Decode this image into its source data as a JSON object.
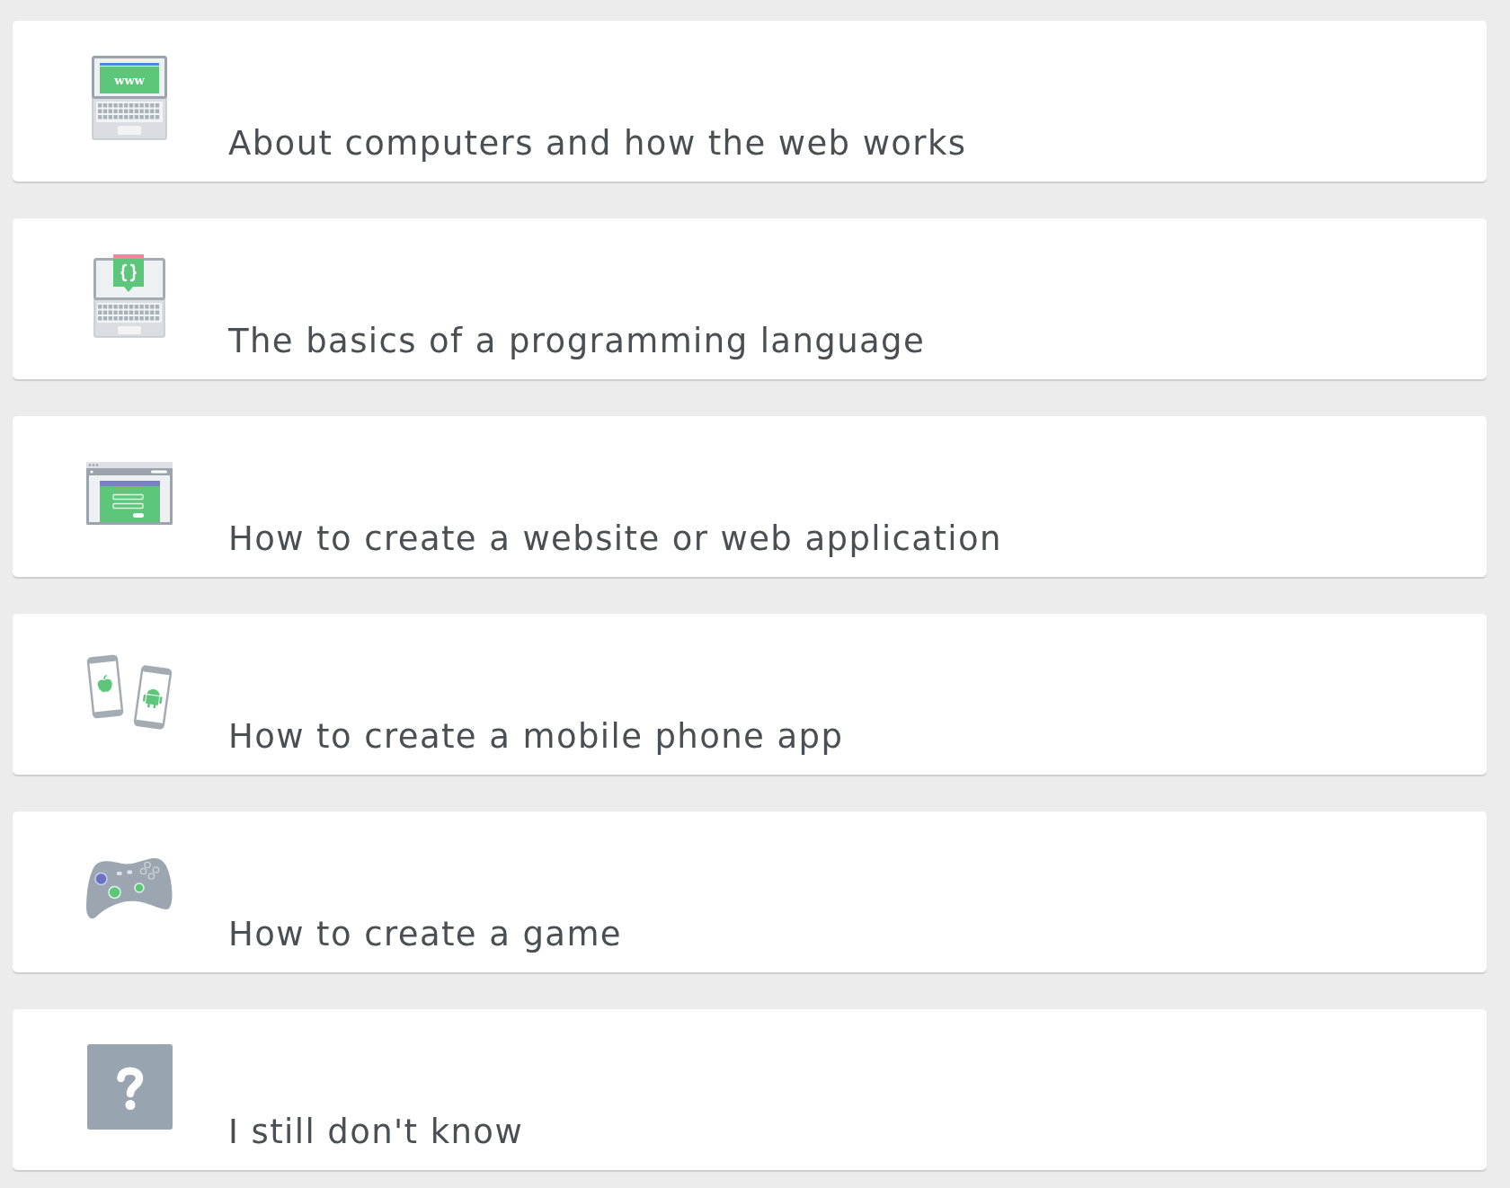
{
  "options": [
    {
      "kind": "laptop-web",
      "icon_text": "www",
      "label": "About computers and how the web works",
      "selected": false
    },
    {
      "kind": "laptop-code",
      "label": "The basics of a programming language",
      "selected": false
    },
    {
      "kind": "browser",
      "label": "How to create a website or web application",
      "selected": false
    },
    {
      "kind": "phones",
      "label": "How to create a mobile phone app",
      "selected": false
    },
    {
      "kind": "gamepad",
      "label": "How to create a game",
      "selected": false
    },
    {
      "kind": "question",
      "label": "I still don't know",
      "selected": false
    }
  ]
}
